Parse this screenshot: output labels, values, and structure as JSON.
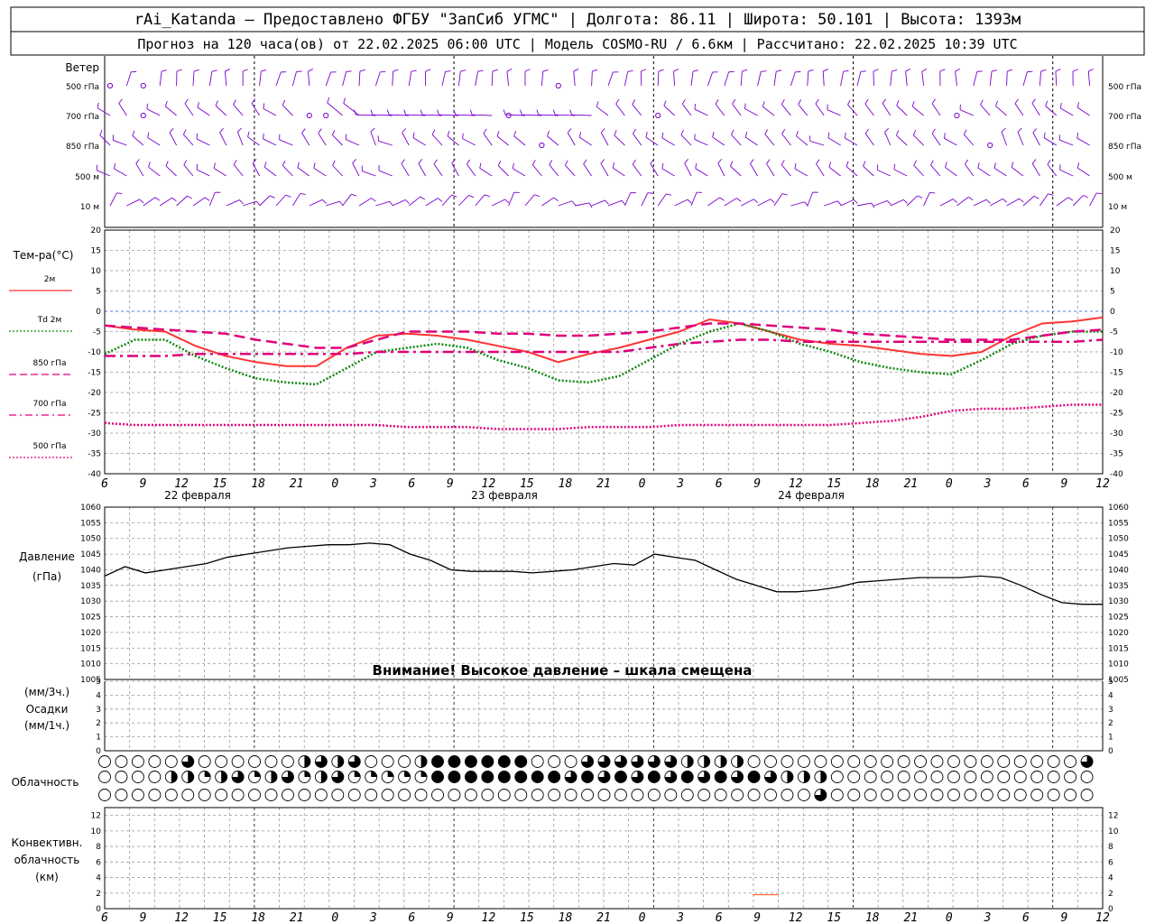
{
  "header": {
    "line1": "rAi_Katanda – Предоставлено ФГБУ \"ЗапСиб УГМС\" | Долгота: 86.11 | Широта: 50.101 | Высота: 1393м",
    "line2": "Прогноз на 120 часа(ов) от 22.02.2025 06:00 UTC  | Модель COSMO-RU / 6.6км | Рассчитано: 22.02.2025 10:39 UTC"
  },
  "wind_panel": {
    "title": "Ветер",
    "levels": [
      "500 гПа",
      "700 гПа",
      "850 гПа",
      "500 м",
      "10 м"
    ],
    "color": "#7a00cc"
  },
  "chart_data": [
    {
      "type": "line",
      "title": "Тем-ра(°C)",
      "ylim": [
        -40,
        20
      ],
      "yticks": [
        20,
        15,
        10,
        5,
        0,
        -5,
        -10,
        -15,
        -20,
        -25,
        -30,
        -35,
        -40
      ],
      "x_hours": [
        6,
        9,
        12,
        15,
        18,
        21,
        24,
        27,
        30,
        33,
        36,
        39,
        42,
        45,
        48,
        51,
        54,
        57,
        60,
        63,
        66,
        69,
        72,
        75,
        78,
        81,
        84,
        87,
        90,
        93,
        96,
        99,
        102,
        105,
        108,
        111,
        114,
        117,
        120,
        123,
        126
      ],
      "series": [
        {
          "name": "2м",
          "color": "#ff3333",
          "style": "solid",
          "values": [
            -3.5,
            -4.5,
            -5,
            -8.5,
            -11,
            -12.5,
            -13.5,
            -13.5,
            -9,
            -6,
            -5.5,
            -6,
            -7,
            -8.5,
            -10,
            -12.5,
            -10.5,
            -9,
            -7,
            -5,
            -2,
            -3,
            -5,
            -7,
            -8,
            -8.5,
            -9.5,
            -10.5,
            -11,
            -10,
            -6,
            -3,
            -2.5,
            -1.5
          ]
        },
        {
          "name": "Td 2м",
          "color": "#118811",
          "style": "dotted",
          "values": [
            -10.5,
            -7,
            -7,
            -11,
            -14,
            -16.5,
            -17.5,
            -18,
            -14,
            -10,
            -9,
            -8,
            -9,
            -12,
            -14,
            -17,
            -17.5,
            -16,
            -12,
            -8,
            -5,
            -3,
            -5,
            -8,
            -10,
            -12.5,
            -14,
            -15,
            -15.5,
            -12,
            -8,
            -6,
            -5,
            -5
          ]
        },
        {
          "name": "850 гПа",
          "color": "#e0007a",
          "style": "dashed",
          "values": [
            -3.5,
            -4,
            -4.5,
            -5,
            -5.5,
            -7,
            -8,
            -9,
            -9,
            -7,
            -5,
            -5,
            -5,
            -5.5,
            -5.5,
            -6,
            -6,
            -5.5,
            -5,
            -4,
            -3,
            -3,
            -3.5,
            -4,
            -4.5,
            -5.5,
            -6,
            -6.5,
            -7,
            -7,
            -7,
            -6,
            -5,
            -4.5
          ]
        },
        {
          "name": "700 гПа",
          "color": "#e0007a",
          "style": "dashdot",
          "values": [
            -11,
            -11,
            -11,
            -10.5,
            -10.5,
            -10.5,
            -10.5,
            -10.5,
            -10.5,
            -10,
            -10,
            -10,
            -10,
            -10,
            -10,
            -10,
            -10,
            -10,
            -9,
            -8,
            -7.5,
            -7,
            -7,
            -7.5,
            -7.5,
            -7.5,
            -7.5,
            -7.5,
            -7.5,
            -7.5,
            -7.5,
            -7.5,
            -7.5,
            -7
          ]
        },
        {
          "name": "500 гПа",
          "color": "#e0007a",
          "style": "dotted",
          "values": [
            -27.5,
            -28,
            -28,
            -28,
            -28,
            -28,
            -28,
            -28,
            -28,
            -28,
            -28.5,
            -28.5,
            -28.5,
            -29,
            -29,
            -29,
            -28.5,
            -28.5,
            -28.5,
            -28,
            -28,
            -28,
            -28,
            -28,
            -28,
            -27.5,
            -27,
            -26,
            -24.5,
            -24,
            -24,
            -23.5,
            -23,
            -23
          ]
        }
      ],
      "xtick_labels": [
        "6",
        "9",
        "12",
        "15",
        "18",
        "21",
        "0",
        "3",
        "6",
        "9",
        "12",
        "15",
        "18",
        "21",
        "0",
        "3",
        "6",
        "9",
        "12",
        "15",
        "18",
        "21",
        "0",
        "3",
        "6",
        "9",
        "12"
      ],
      "date_labels": [
        "22 февраля",
        "23 февраля",
        "24 февраля"
      ]
    },
    {
      "type": "line",
      "title": "Давление",
      "unit": "(гПа)",
      "ylim": [
        1005,
        1060
      ],
      "yticks": [
        1060,
        1055,
        1050,
        1045,
        1040,
        1035,
        1030,
        1025,
        1020,
        1015,
        1010,
        1005
      ],
      "warning": "Внимание! Высокое давление – шкала смещена",
      "series": [
        {
          "name": "Давление",
          "color": "#000000",
          "values": [
            1038,
            1041,
            1039,
            1040,
            1041,
            1042,
            1044,
            1045,
            1046,
            1047,
            1047.5,
            1048,
            1048,
            1048.5,
            1048,
            1045,
            1043,
            1040,
            1039.5,
            1039.5,
            1039.5,
            1039,
            1039.5,
            1040,
            1041,
            1042,
            1041.5,
            1045,
            1044,
            1043,
            1040,
            1037,
            1035,
            1033,
            1033,
            1033.5,
            1034.5,
            1036,
            1036.5,
            1037,
            1037.5,
            1037.5,
            1037.5,
            1038,
            1037.5,
            1035,
            1032,
            1029.5,
            1029,
            1029
          ]
        }
      ]
    },
    {
      "type": "bar",
      "title": "Осадки",
      "units": [
        "(мм/3ч.)",
        "(мм/1ч.)"
      ],
      "ylim": [
        0,
        5
      ],
      "yticks": [
        5,
        4,
        3,
        2,
        1,
        0
      ],
      "values": []
    },
    {
      "type": "table",
      "title": "Облачность",
      "rows": 3,
      "columns": 60
    },
    {
      "type": "bar",
      "title": "Конвективн. облачность (км)",
      "ylim": [
        0,
        13
      ],
      "yticks": [
        12,
        10,
        8,
        6,
        4,
        2,
        0
      ],
      "segments": [
        {
          "x_hour": 84,
          "from_km": 1.7,
          "to_km": 1.9,
          "color": "#ff6633"
        }
      ]
    }
  ]
}
